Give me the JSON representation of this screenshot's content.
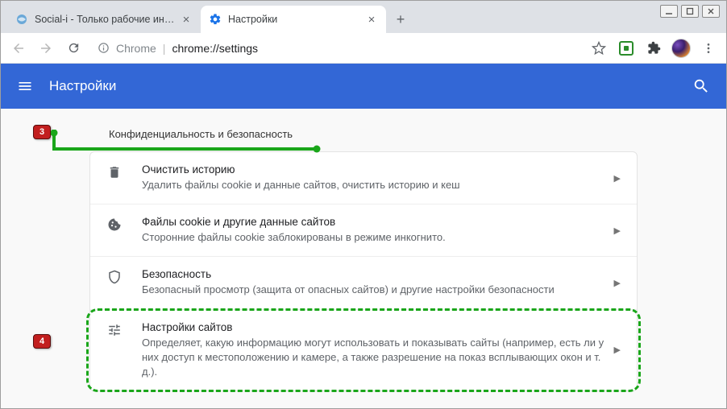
{
  "window": {
    "tabs": [
      {
        "title": "Social-i - Только рабочие инстр"
      },
      {
        "title": "Настройки"
      }
    ]
  },
  "address": {
    "protocol": "Chrome",
    "url": "chrome://settings"
  },
  "header": {
    "title": "Настройки"
  },
  "section": {
    "heading": "Конфиденциальность и безопасность",
    "rows": [
      {
        "title": "Очистить историю",
        "desc": "Удалить файлы cookie и данные сайтов, очистить историю и кеш"
      },
      {
        "title": "Файлы cookie и другие данные сайтов",
        "desc": "Сторонние файлы cookie заблокированы в режиме инкогнито."
      },
      {
        "title": "Безопасность",
        "desc": "Безопасный просмотр (защита от опасных сайтов) и другие настройки безопасности"
      },
      {
        "title": "Настройки сайтов",
        "desc": "Определяет, какую информацию могут использовать и показывать сайты (например, есть ли у них доступ к местоположению и камере, а также разрешение на показ всплывающих окон и т. д.)."
      }
    ]
  },
  "annotations": {
    "badge3": "3",
    "badge4": "4"
  }
}
